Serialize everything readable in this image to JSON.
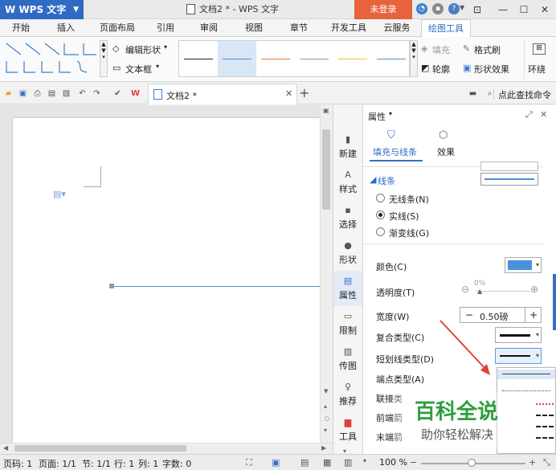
{
  "titlebar": {
    "app_name": "W WPS 文字",
    "window_title": "文档2 * - WPS 文字",
    "login_label": "未登录",
    "controls": [
      "minimize",
      "maximize",
      "close"
    ]
  },
  "tabs": [
    "开始",
    "插入",
    "页面布局",
    "引用",
    "审阅",
    "视图",
    "章节",
    "开发工具",
    "云服务",
    "绘图工具"
  ],
  "active_tab": "绘图工具",
  "ribbon": {
    "edit_shape": "编辑形状",
    "text_box": "文本框",
    "fill": "填充",
    "format_brush": "格式刷",
    "outline": "轮廓",
    "shape_effect": "形状效果",
    "wrap": "环绕"
  },
  "qat": {
    "doc_tab": "文档2 *",
    "search": "点此查找命令"
  },
  "sidebar": {
    "items": [
      "新建",
      "样式",
      "选择",
      "形状",
      "属性",
      "限制",
      "传图",
      "推荐",
      "工具"
    ],
    "active": "属性"
  },
  "panel": {
    "title": "属性",
    "tabs": [
      "填充与线条",
      "效果"
    ],
    "section": "线条",
    "line_options": [
      "无线条(N)",
      "实线(S)",
      "渐变线(G)"
    ],
    "selected_line_option": "实线(S)",
    "color_label": "颜色(C)",
    "color_value": "#4a90d9",
    "transparency_label": "透明度(T)",
    "transparency_value": "0%",
    "width_label": "宽度(W)",
    "width_value": "0.50磅",
    "compound_label": "复合类型(C)",
    "dash_label": "短划线类型(D)",
    "cap_label": "端点类型(A)",
    "join_label": "联接类",
    "begin_label": "前端箭",
    "end_label": "末端箭"
  },
  "watermark": {
    "line1": "百科全说",
    "line2": "助你轻松解决"
  },
  "status": {
    "page_num": "页码: 1",
    "pages": "页面: 1/1",
    "section": "节: 1/1",
    "row": "行: 1",
    "col": "列: 1",
    "word_count": "字数: 0",
    "zoom": "100 %"
  },
  "colors": {
    "accent": "#2f6bc4",
    "login": "#e8623c",
    "arrow": "#e0403a"
  }
}
